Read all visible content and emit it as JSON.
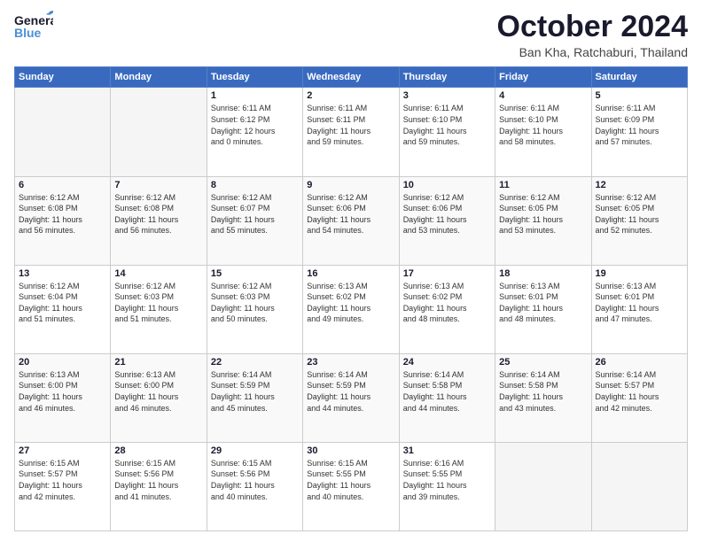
{
  "header": {
    "logo_general": "General",
    "logo_blue": "Blue",
    "month_title": "October 2024",
    "location": "Ban Kha, Ratchaburi, Thailand"
  },
  "weekdays": [
    "Sunday",
    "Monday",
    "Tuesday",
    "Wednesday",
    "Thursday",
    "Friday",
    "Saturday"
  ],
  "weeks": [
    [
      {
        "day": "",
        "info": ""
      },
      {
        "day": "",
        "info": ""
      },
      {
        "day": "1",
        "info": "Sunrise: 6:11 AM\nSunset: 6:12 PM\nDaylight: 12 hours\nand 0 minutes."
      },
      {
        "day": "2",
        "info": "Sunrise: 6:11 AM\nSunset: 6:11 PM\nDaylight: 11 hours\nand 59 minutes."
      },
      {
        "day": "3",
        "info": "Sunrise: 6:11 AM\nSunset: 6:10 PM\nDaylight: 11 hours\nand 59 minutes."
      },
      {
        "day": "4",
        "info": "Sunrise: 6:11 AM\nSunset: 6:10 PM\nDaylight: 11 hours\nand 58 minutes."
      },
      {
        "day": "5",
        "info": "Sunrise: 6:11 AM\nSunset: 6:09 PM\nDaylight: 11 hours\nand 57 minutes."
      }
    ],
    [
      {
        "day": "6",
        "info": "Sunrise: 6:12 AM\nSunset: 6:08 PM\nDaylight: 11 hours\nand 56 minutes."
      },
      {
        "day": "7",
        "info": "Sunrise: 6:12 AM\nSunset: 6:08 PM\nDaylight: 11 hours\nand 56 minutes."
      },
      {
        "day": "8",
        "info": "Sunrise: 6:12 AM\nSunset: 6:07 PM\nDaylight: 11 hours\nand 55 minutes."
      },
      {
        "day": "9",
        "info": "Sunrise: 6:12 AM\nSunset: 6:06 PM\nDaylight: 11 hours\nand 54 minutes."
      },
      {
        "day": "10",
        "info": "Sunrise: 6:12 AM\nSunset: 6:06 PM\nDaylight: 11 hours\nand 53 minutes."
      },
      {
        "day": "11",
        "info": "Sunrise: 6:12 AM\nSunset: 6:05 PM\nDaylight: 11 hours\nand 53 minutes."
      },
      {
        "day": "12",
        "info": "Sunrise: 6:12 AM\nSunset: 6:05 PM\nDaylight: 11 hours\nand 52 minutes."
      }
    ],
    [
      {
        "day": "13",
        "info": "Sunrise: 6:12 AM\nSunset: 6:04 PM\nDaylight: 11 hours\nand 51 minutes."
      },
      {
        "day": "14",
        "info": "Sunrise: 6:12 AM\nSunset: 6:03 PM\nDaylight: 11 hours\nand 51 minutes."
      },
      {
        "day": "15",
        "info": "Sunrise: 6:12 AM\nSunset: 6:03 PM\nDaylight: 11 hours\nand 50 minutes."
      },
      {
        "day": "16",
        "info": "Sunrise: 6:13 AM\nSunset: 6:02 PM\nDaylight: 11 hours\nand 49 minutes."
      },
      {
        "day": "17",
        "info": "Sunrise: 6:13 AM\nSunset: 6:02 PM\nDaylight: 11 hours\nand 48 minutes."
      },
      {
        "day": "18",
        "info": "Sunrise: 6:13 AM\nSunset: 6:01 PM\nDaylight: 11 hours\nand 48 minutes."
      },
      {
        "day": "19",
        "info": "Sunrise: 6:13 AM\nSunset: 6:01 PM\nDaylight: 11 hours\nand 47 minutes."
      }
    ],
    [
      {
        "day": "20",
        "info": "Sunrise: 6:13 AM\nSunset: 6:00 PM\nDaylight: 11 hours\nand 46 minutes."
      },
      {
        "day": "21",
        "info": "Sunrise: 6:13 AM\nSunset: 6:00 PM\nDaylight: 11 hours\nand 46 minutes."
      },
      {
        "day": "22",
        "info": "Sunrise: 6:14 AM\nSunset: 5:59 PM\nDaylight: 11 hours\nand 45 minutes."
      },
      {
        "day": "23",
        "info": "Sunrise: 6:14 AM\nSunset: 5:59 PM\nDaylight: 11 hours\nand 44 minutes."
      },
      {
        "day": "24",
        "info": "Sunrise: 6:14 AM\nSunset: 5:58 PM\nDaylight: 11 hours\nand 44 minutes."
      },
      {
        "day": "25",
        "info": "Sunrise: 6:14 AM\nSunset: 5:58 PM\nDaylight: 11 hours\nand 43 minutes."
      },
      {
        "day": "26",
        "info": "Sunrise: 6:14 AM\nSunset: 5:57 PM\nDaylight: 11 hours\nand 42 minutes."
      }
    ],
    [
      {
        "day": "27",
        "info": "Sunrise: 6:15 AM\nSunset: 5:57 PM\nDaylight: 11 hours\nand 42 minutes."
      },
      {
        "day": "28",
        "info": "Sunrise: 6:15 AM\nSunset: 5:56 PM\nDaylight: 11 hours\nand 41 minutes."
      },
      {
        "day": "29",
        "info": "Sunrise: 6:15 AM\nSunset: 5:56 PM\nDaylight: 11 hours\nand 40 minutes."
      },
      {
        "day": "30",
        "info": "Sunrise: 6:15 AM\nSunset: 5:55 PM\nDaylight: 11 hours\nand 40 minutes."
      },
      {
        "day": "31",
        "info": "Sunrise: 6:16 AM\nSunset: 5:55 PM\nDaylight: 11 hours\nand 39 minutes."
      },
      {
        "day": "",
        "info": ""
      },
      {
        "day": "",
        "info": ""
      }
    ]
  ]
}
